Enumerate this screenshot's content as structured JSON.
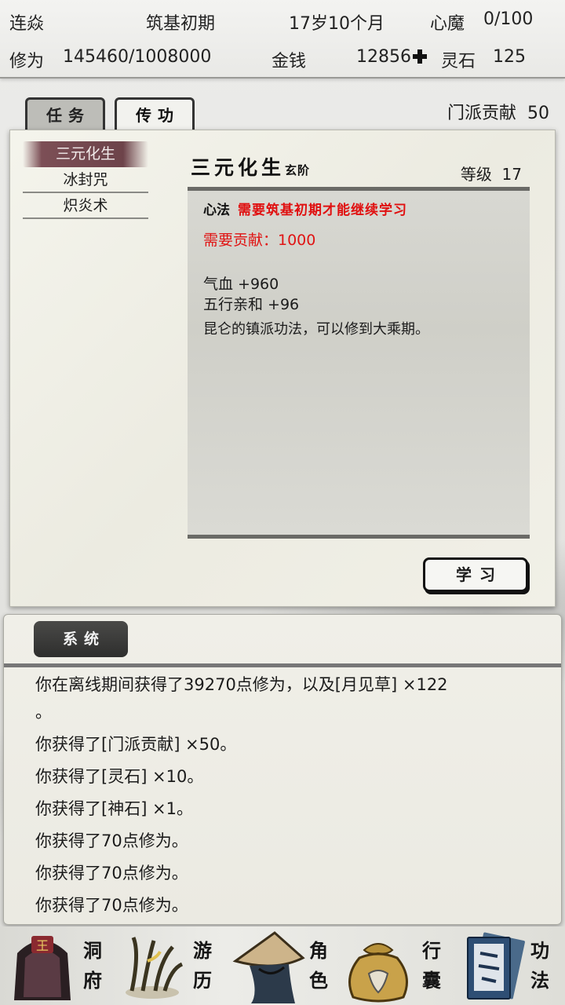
{
  "status": {
    "name": "连焱",
    "realm": "筑基初期",
    "age": "17岁10个月",
    "demon_label": "心魔",
    "demon_value": "0/100",
    "cultivation_label": "修为",
    "cultivation_value": "145460/1008000",
    "money_label": "金钱",
    "money_value": "12856",
    "spirit_stone_label": "灵石",
    "spirit_stone_value": "125"
  },
  "tabs": [
    {
      "label": "任务",
      "active": false
    },
    {
      "label": "传功",
      "active": true
    }
  ],
  "sect_contribution": {
    "label": "门派贡献",
    "value": "50"
  },
  "skills": [
    {
      "name": "三元化生",
      "selected": true
    },
    {
      "name": "冰封咒",
      "selected": false
    },
    {
      "name": "炽炎术",
      "selected": false
    }
  ],
  "skill_detail": {
    "name": "三元化生",
    "grade": "玄阶",
    "level_label": "等级",
    "level": "17",
    "type": "心法",
    "requirement": "需要筑基初期才能继续学习",
    "cost": "需要贡献：1000",
    "stats": [
      "气血 +960",
      "五行亲和 +96"
    ],
    "description": "昆仑的镇派功法，可以修到大乘期。",
    "learn_label": "学习"
  },
  "log": {
    "tab_label": "系统",
    "lines": [
      "你在离线期间获得了39270点修为，以及[月见草] ×122",
      "。",
      "你获得了[门派贡献] ×50。",
      "你获得了[灵石] ×10。",
      "你获得了[神石] ×1。",
      "你获得了70点修为。",
      "你获得了70点修为。",
      "你获得了70点修为。"
    ]
  },
  "nav": [
    {
      "label_1": "洞",
      "label_2": "府",
      "icon": "cave-dwelling-icon"
    },
    {
      "label_1": "游",
      "label_2": "历",
      "icon": "travel-icon"
    },
    {
      "label_1": "角",
      "label_2": "色",
      "icon": "character-icon"
    },
    {
      "label_1": "行",
      "label_2": "囊",
      "icon": "bag-icon"
    },
    {
      "label_1": "功",
      "label_2": "法",
      "icon": "manual-icon"
    }
  ],
  "colors": {
    "accent_red": "#e01010",
    "selected_item": "#6d434a",
    "panel_paper": "#f1f0e7"
  }
}
